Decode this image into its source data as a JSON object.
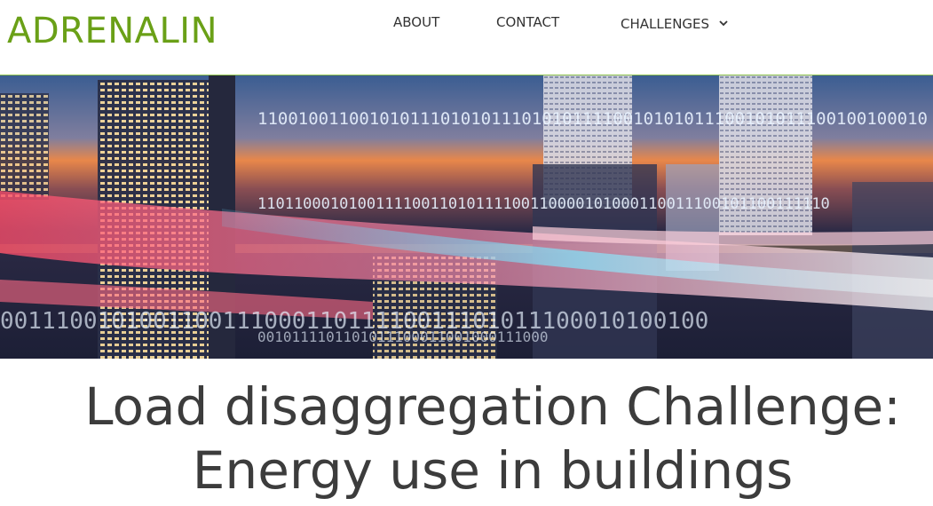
{
  "brand": {
    "name": "ADRENALIN",
    "color": "#6aa017"
  },
  "nav": {
    "items": [
      {
        "label": "ABOUT"
      },
      {
        "label": "CONTACT"
      },
      {
        "label": "CHALLENGES",
        "icon": "chevron-down-icon"
      }
    ]
  },
  "hero": {
    "image": "city-skyline-with-binary-light-streaks",
    "binary_rows": [
      "110010011001010111010101110101011110010101011100101011100100100010",
      "110110001010011110011010111100110000101000110011100101100111110",
      "001110010100110011100011011110011101011100010100100",
      "0010111101101011100011001000111000"
    ]
  },
  "page": {
    "title_line1": "Load disaggregation Challenge:",
    "title_line2": "Energy use in buildings"
  }
}
